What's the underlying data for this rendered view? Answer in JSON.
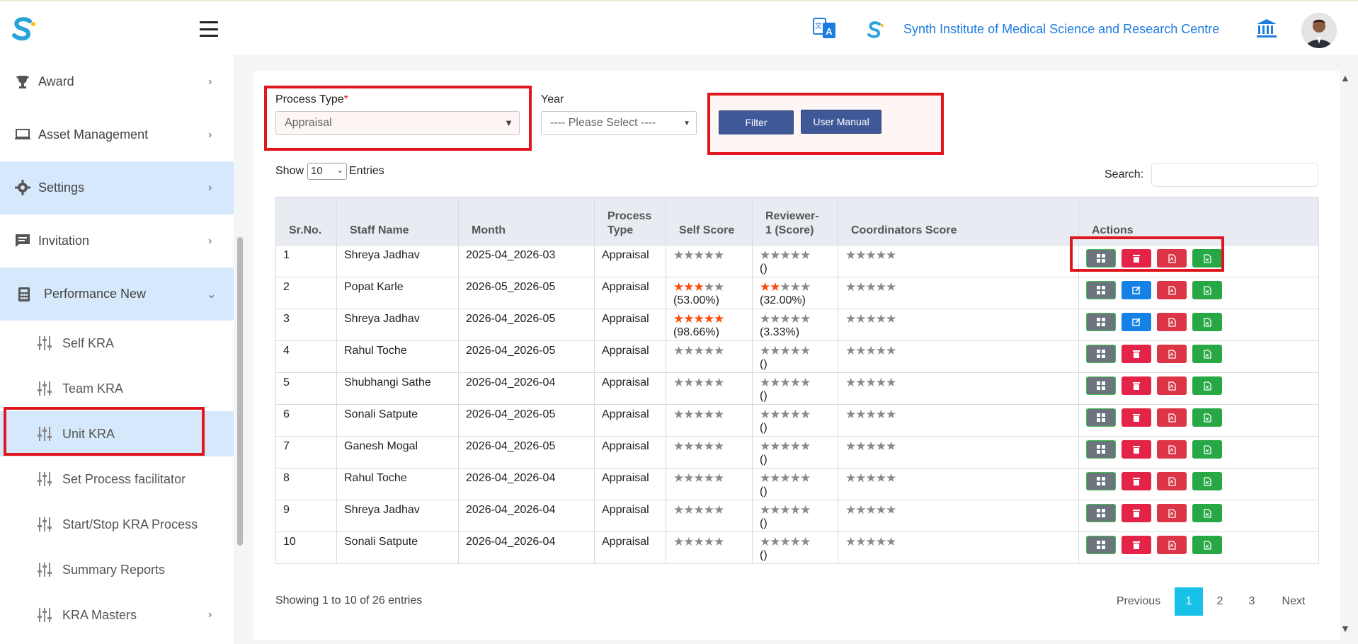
{
  "header": {
    "institute_name": "Synth Institute of Medical Science and Research Centre",
    "brand_color": "#1e7be0",
    "icons": [
      "app-logo",
      "translate-icon",
      "institute-logo",
      "bank-icon",
      "user-avatar"
    ]
  },
  "sidebar": {
    "items": [
      {
        "label": "Award",
        "icon": "trophy-icon"
      },
      {
        "label": "Asset Management",
        "icon": "laptop-icon"
      },
      {
        "label": "Settings",
        "icon": "gear-icon"
      },
      {
        "label": "Invitation",
        "icon": "message-icon"
      },
      {
        "label": "Performance New",
        "icon": "calculator-icon"
      }
    ],
    "subitems": [
      {
        "label": "Self KRA"
      },
      {
        "label": "Team KRA"
      },
      {
        "label": "Unit KRA"
      },
      {
        "label": "Set Process facilitator"
      },
      {
        "label": "Start/Stop KRA Process"
      },
      {
        "label": "Summary Reports"
      },
      {
        "label": "KRA Masters"
      }
    ]
  },
  "filters": {
    "process_type_label": "Process Type",
    "required_mark": "*",
    "process_type_value": "Appraisal",
    "year_label": "Year",
    "year_value": "---- Please Select ----",
    "filter_button": "Filter",
    "manual_button": "User Manual"
  },
  "table_controls": {
    "show_label": "Show",
    "entries_value": "10",
    "entries_label": "Entries",
    "search_label": "Search:"
  },
  "table": {
    "headers": [
      "Sr.No.",
      "Staff Name",
      "Month",
      "Process Type",
      "Self Score",
      "Reviewer-1 (Score)",
      "Coordinators Score",
      "Actions"
    ],
    "rows": [
      {
        "sr": "1",
        "name": "Shreya Jadhav",
        "month": "2025-04_2026-03",
        "type": "Appraisal",
        "self_stars": 0,
        "self_pct": "",
        "rev_stars": 0,
        "rev_pct": "()",
        "coord_stars": 0,
        "edit_icon": false
      },
      {
        "sr": "2",
        "name": "Popat Karle",
        "month": "2026-05_2026-05",
        "type": "Appraisal",
        "self_stars": 3,
        "self_pct": "(53.00%)",
        "rev_stars": 2,
        "rev_pct": "(32.00%)",
        "coord_stars": 0,
        "edit_icon": true
      },
      {
        "sr": "3",
        "name": "Shreya Jadhav",
        "month": "2026-04_2026-05",
        "type": "Appraisal",
        "self_stars": 5,
        "self_pct": "(98.66%)",
        "rev_stars": 0,
        "rev_pct": "(3.33%)",
        "coord_stars": 0,
        "edit_icon": true
      },
      {
        "sr": "4",
        "name": "Rahul Toche",
        "month": "2026-04_2026-05",
        "type": "Appraisal",
        "self_stars": 0,
        "self_pct": "",
        "rev_stars": 0,
        "rev_pct": "()",
        "coord_stars": 0,
        "edit_icon": false
      },
      {
        "sr": "5",
        "name": "Shubhangi Sathe",
        "month": "2026-04_2026-04",
        "type": "Appraisal",
        "self_stars": 0,
        "self_pct": "",
        "rev_stars": 0,
        "rev_pct": "()",
        "coord_stars": 0,
        "edit_icon": false
      },
      {
        "sr": "6",
        "name": "Sonali Satpute",
        "month": "2026-04_2026-05",
        "type": "Appraisal",
        "self_stars": 0,
        "self_pct": "",
        "rev_stars": 0,
        "rev_pct": "()",
        "coord_stars": 0,
        "edit_icon": false
      },
      {
        "sr": "7",
        "name": "Ganesh Mogal",
        "month": "2026-04_2026-05",
        "type": "Appraisal",
        "self_stars": 0,
        "self_pct": "",
        "rev_stars": 0,
        "rev_pct": "()",
        "coord_stars": 0,
        "edit_icon": false
      },
      {
        "sr": "8",
        "name": "Rahul Toche",
        "month": "2026-04_2026-04",
        "type": "Appraisal",
        "self_stars": 0,
        "self_pct": "",
        "rev_stars": 0,
        "rev_pct": "()",
        "coord_stars": 0,
        "edit_icon": false
      },
      {
        "sr": "9",
        "name": "Shreya Jadhav",
        "month": "2026-04_2026-04",
        "type": "Appraisal",
        "self_stars": 0,
        "self_pct": "",
        "rev_stars": 0,
        "rev_pct": "()",
        "coord_stars": 0,
        "edit_icon": false
      },
      {
        "sr": "10",
        "name": "Sonali Satpute",
        "month": "2026-04_2026-04",
        "type": "Appraisal",
        "self_stars": 0,
        "self_pct": "",
        "rev_stars": 0,
        "rev_pct": "()",
        "coord_stars": 0,
        "edit_icon": false
      }
    ]
  },
  "footer": {
    "showing_text": "Showing 1 to 10 of 26 entries",
    "previous": "Previous",
    "pages": [
      "1",
      "2",
      "3"
    ],
    "current_page": "1",
    "next": "Next"
  },
  "colors": {
    "highlight_border": "#e0161e",
    "active_sidebar": "#d6e8fb",
    "primary_button": "#3f5897",
    "star_filled": "#ff4a0a",
    "star_empty": "#8a8a8a",
    "pager_current": "#17c1e8"
  }
}
